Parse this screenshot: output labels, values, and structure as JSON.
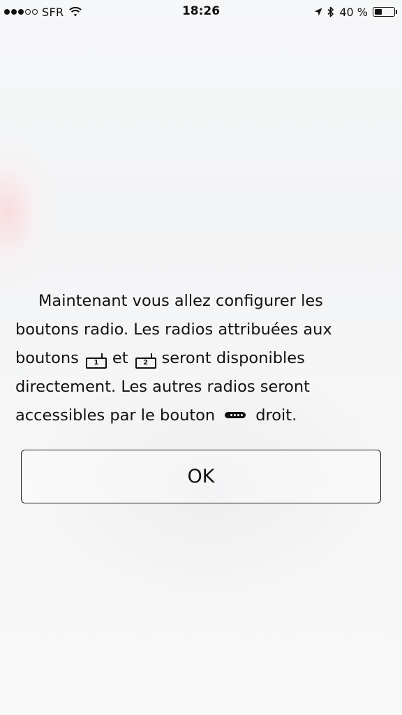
{
  "status_bar": {
    "carrier": "SFR",
    "time": "18:26",
    "battery_percent": "40 %",
    "battery_level": 0.4,
    "signal_bars_filled": 3,
    "signal_bars_total": 5,
    "icons": [
      "wifi-icon",
      "location-arrow-icon",
      "bluetooth-icon",
      "battery-icon"
    ]
  },
  "message": {
    "line1": "Maintenant vous allez configurer les",
    "line2": "boutons radio. Les radios attribuées aux",
    "line3_a": "boutons",
    "radio_button_1": "1",
    "line3_b": "et",
    "radio_button_2": "2",
    "line3_c": "seront disponibles",
    "line4": "directement. Les autres radios seront",
    "line5_a": "accessibles par le bouton",
    "line5_b": "droit."
  },
  "ok_button": {
    "label": "OK"
  },
  "colors": {
    "text": "#111111",
    "border": "#222222"
  }
}
